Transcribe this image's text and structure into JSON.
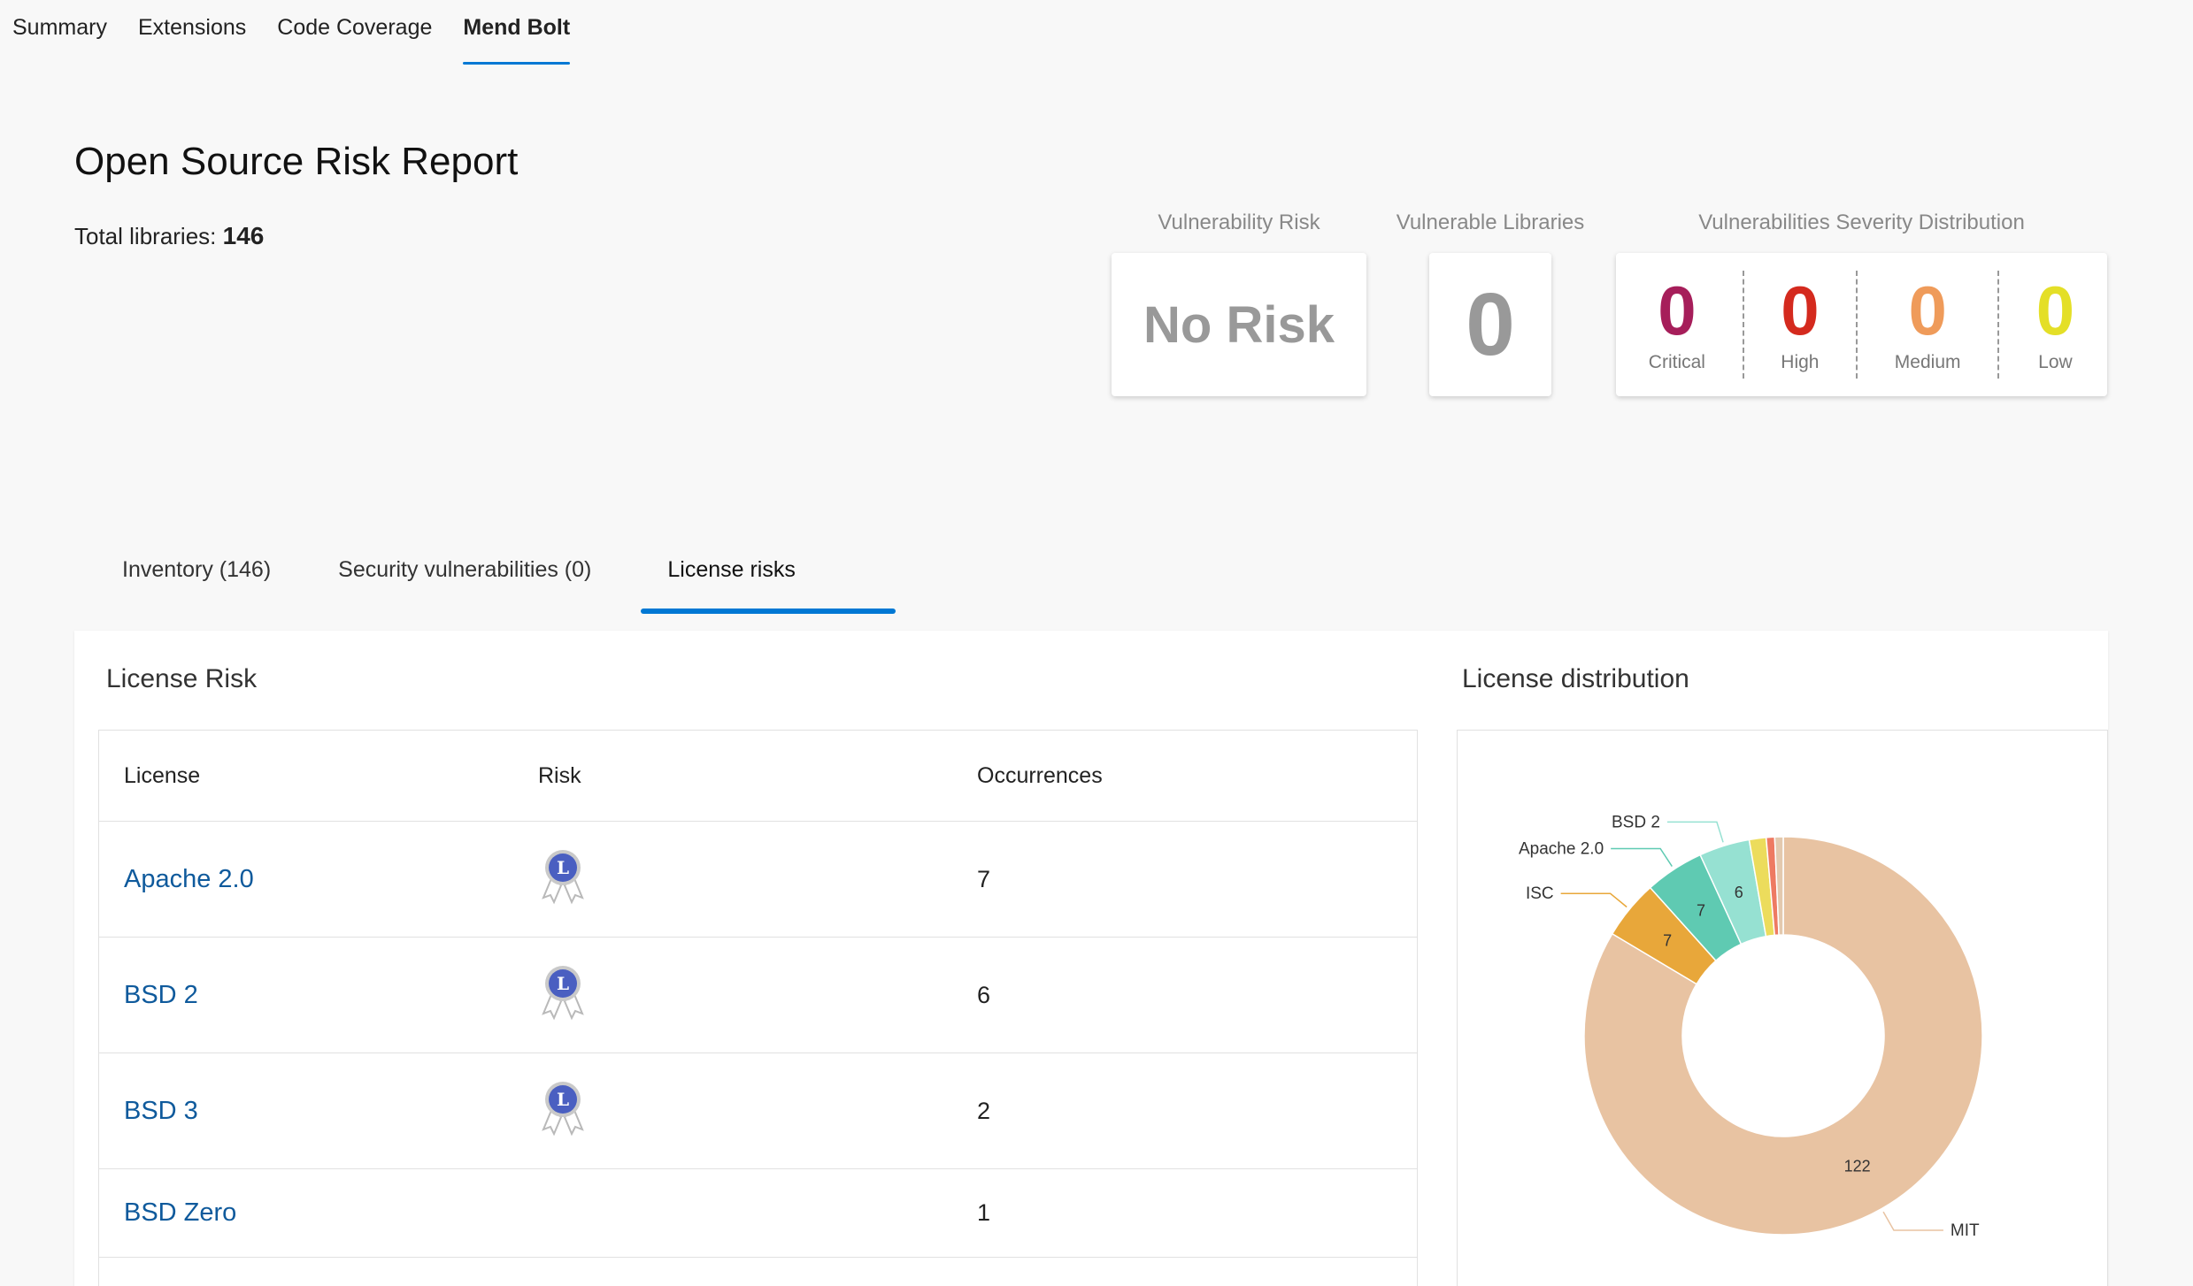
{
  "top_tabs": [
    {
      "label": "Summary",
      "active": false
    },
    {
      "label": "Extensions",
      "active": false
    },
    {
      "label": "Code Coverage",
      "active": false
    },
    {
      "label": "Mend Bolt",
      "active": true
    }
  ],
  "report": {
    "title": "Open Source Risk Report",
    "total_label": "Total libraries:",
    "total_value": "146"
  },
  "cards": {
    "vulnerability_risk": {
      "label": "Vulnerability Risk",
      "value": "No Risk"
    },
    "vulnerable_libraries": {
      "label": "Vulnerable Libraries",
      "value": "0"
    },
    "severity": {
      "label": "Vulnerabilities Severity Distribution",
      "items": [
        {
          "label": "Critical",
          "value": "0",
          "color": "#a61e5a"
        },
        {
          "label": "High",
          "value": "0",
          "color": "#d42a1e"
        },
        {
          "label": "Medium",
          "value": "0",
          "color": "#ef9b5a"
        },
        {
          "label": "Low",
          "value": "0",
          "color": "#e4df27"
        }
      ]
    }
  },
  "sub_tabs": [
    {
      "label": "Inventory (146)",
      "active": false
    },
    {
      "label": "Security vulnerabilities (0)",
      "active": false
    },
    {
      "label": "License risks",
      "active": true
    }
  ],
  "license_risk": {
    "title": "License Risk",
    "columns": [
      "License",
      "Risk",
      "Occurrences"
    ],
    "rows": [
      {
        "license": "Apache 2.0",
        "risk_icon": "low-risk-ribbon-icon",
        "risk_letter": "L",
        "occurrences": "7"
      },
      {
        "license": "BSD 2",
        "risk_icon": "low-risk-ribbon-icon",
        "risk_letter": "L",
        "occurrences": "6"
      },
      {
        "license": "BSD 3",
        "risk_icon": "low-risk-ribbon-icon",
        "risk_letter": "L",
        "occurrences": "2"
      },
      {
        "license": "BSD Zero",
        "risk_icon": "",
        "risk_letter": "",
        "occurrences": "1"
      }
    ]
  },
  "license_distribution": {
    "title": "License distribution"
  },
  "chart_data": {
    "type": "pie",
    "donut": true,
    "title": "",
    "slices": [
      {
        "name": "MIT",
        "value": 122,
        "color": "#e8c3a2",
        "label": "MIT",
        "value_label": "122"
      },
      {
        "name": "ISC",
        "value": 7,
        "color": "#e8a73a",
        "label": "ISC",
        "value_label": "7"
      },
      {
        "name": "Apache 2.0",
        "value": 7,
        "color": "#5fcab2",
        "label": "Apache 2.0",
        "value_label": "7"
      },
      {
        "name": "BSD 2",
        "value": 6,
        "color": "#96e1d2",
        "label": "BSD 2",
        "value_label": "6"
      },
      {
        "name": "",
        "value": 2,
        "color": "#ecdc5c",
        "label": "",
        "value_label": ""
      },
      {
        "name": "",
        "value": 1,
        "color": "#ee7a62",
        "label": "",
        "value_label": ""
      },
      {
        "name": "",
        "value": 1,
        "color": "#e3c9ae",
        "label": "",
        "value_label": ""
      }
    ]
  }
}
